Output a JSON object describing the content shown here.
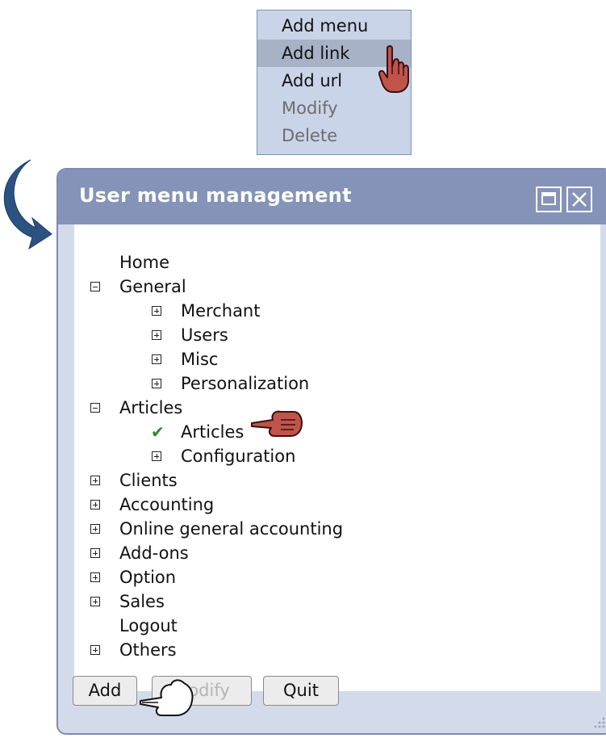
{
  "context_menu": {
    "items": [
      {
        "label": "Add menu",
        "state": "normal"
      },
      {
        "label": "Add link",
        "state": "hover"
      },
      {
        "label": "Add url",
        "state": "normal"
      },
      {
        "label": "Modify",
        "state": "disabled"
      },
      {
        "label": "Delete",
        "state": "disabled"
      }
    ]
  },
  "window": {
    "title": "User menu management",
    "tree": [
      {
        "label": "Home",
        "toggle": "none"
      },
      {
        "label": "General",
        "toggle": "minus"
      },
      {
        "label": "Merchant",
        "toggle": "plus"
      },
      {
        "label": "Users",
        "toggle": "plus"
      },
      {
        "label": "Misc",
        "toggle": "plus"
      },
      {
        "label": "Personalization",
        "toggle": "plus"
      },
      {
        "label": "Articles",
        "toggle": "minus"
      },
      {
        "label": "Articles",
        "toggle": "check",
        "selected": true
      },
      {
        "label": "Configuration",
        "toggle": "plus"
      },
      {
        "label": "Clients",
        "toggle": "plus"
      },
      {
        "label": "Accounting",
        "toggle": "plus"
      },
      {
        "label": "Online general accounting",
        "toggle": "plus"
      },
      {
        "label": "Add-ons",
        "toggle": "plus"
      },
      {
        "label": "Option",
        "toggle": "plus"
      },
      {
        "label": "Sales",
        "toggle": "plus"
      },
      {
        "label": "Logout",
        "toggle": "none"
      },
      {
        "label": "Others",
        "toggle": "plus"
      }
    ],
    "buttons": {
      "add": "Add",
      "modify": "Modify",
      "quit": "Quit"
    }
  },
  "icons": {
    "pointer_hand": "hand-pointer-icon",
    "curved_arrow": "curved-arrow-icon",
    "maximize": "maximize-icon",
    "close": "close-icon"
  },
  "colors": {
    "titlebar": "#8593b8",
    "window_bg": "#d3dbeb",
    "menu_bg": "#c9d4e8",
    "menu_hover": "#a7b2c7",
    "arrow": "#2c5282",
    "hand_red": "#c0544a",
    "check_green": "#2a8a2a"
  }
}
